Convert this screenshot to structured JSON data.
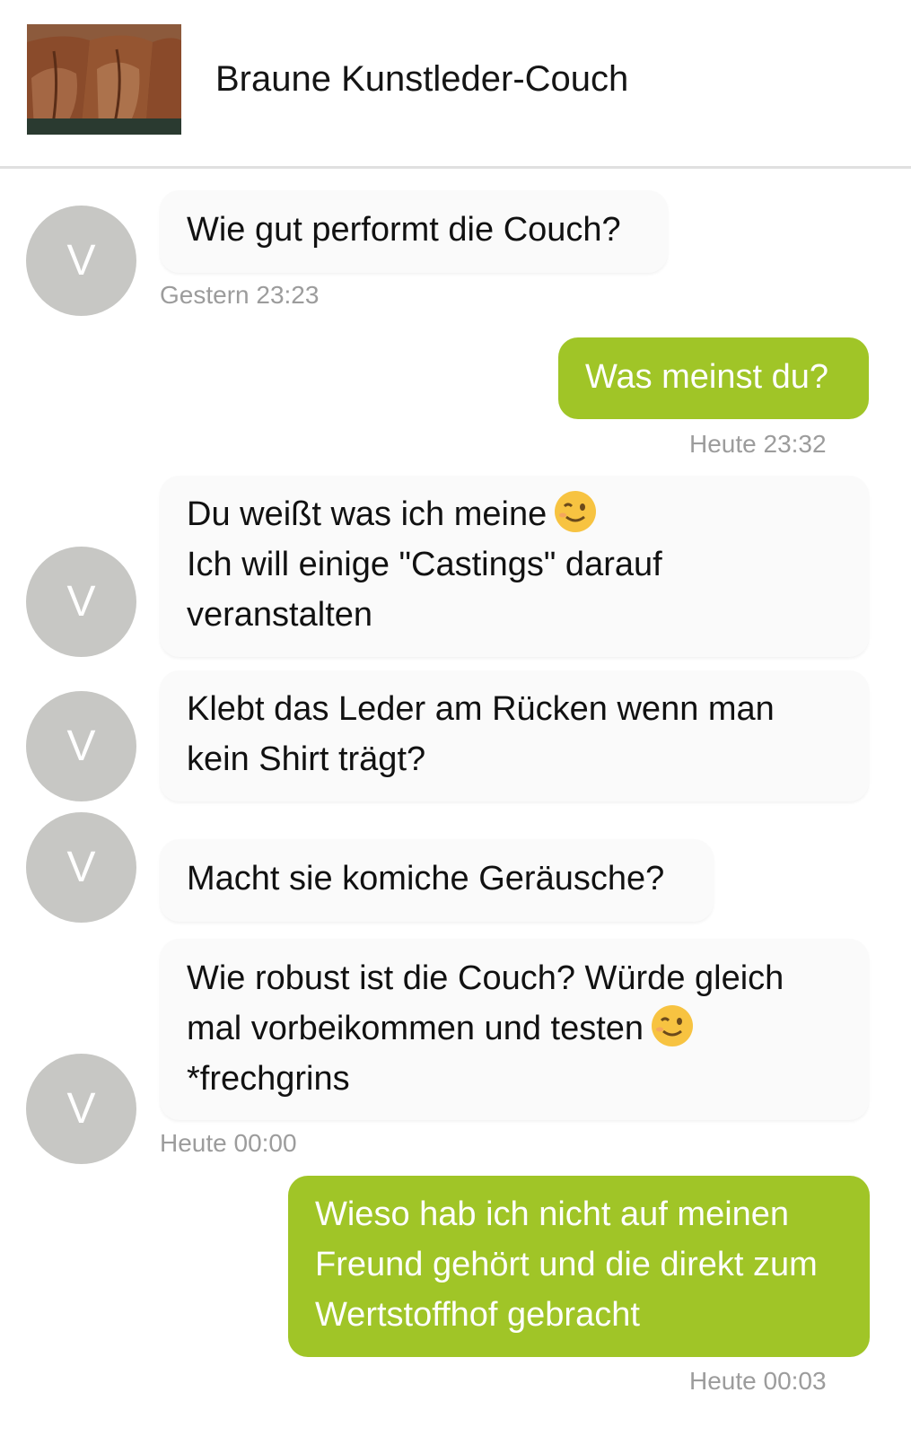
{
  "header": {
    "title": "Braune Kunstleder-Couch"
  },
  "avatar_letter": "V",
  "messages": {
    "m1": {
      "lines": [
        "Wie gut performt die Couch?"
      ],
      "time": "Gestern 23:23"
    },
    "m2": {
      "lines": [
        "Was meinst du?"
      ],
      "time": "Heute 23:32"
    },
    "m3": {
      "lines": [
        "Du weißt was ich meine",
        "Ich will einige \"Castings\" darauf",
        "veranstalten"
      ],
      "emoji": "wink-emoji-icon"
    },
    "m4": {
      "lines": [
        "Klebt das Leder am Rücken wenn man",
        "kein Shirt trägt?"
      ]
    },
    "m5": {
      "lines": [
        "Macht sie komiche Geräusche?"
      ]
    },
    "m6": {
      "lines": [
        "Wie robust ist die Couch? Würde gleich",
        "mal vorbeikommen und testen",
        "*frechgrins"
      ],
      "time": "Heute 00:00",
      "emoji": "wink-emoji-icon"
    },
    "m7": {
      "lines": [
        "Wieso hab ich nicht auf meinen",
        "Freund gehört und die direkt zum",
        "Wertstoffhof gebracht"
      ],
      "time": "Heute 00:03"
    }
  },
  "colors": {
    "outgoing": "#a0c527",
    "incoming": "#fafafa",
    "avatar": "#c7c7c4"
  }
}
